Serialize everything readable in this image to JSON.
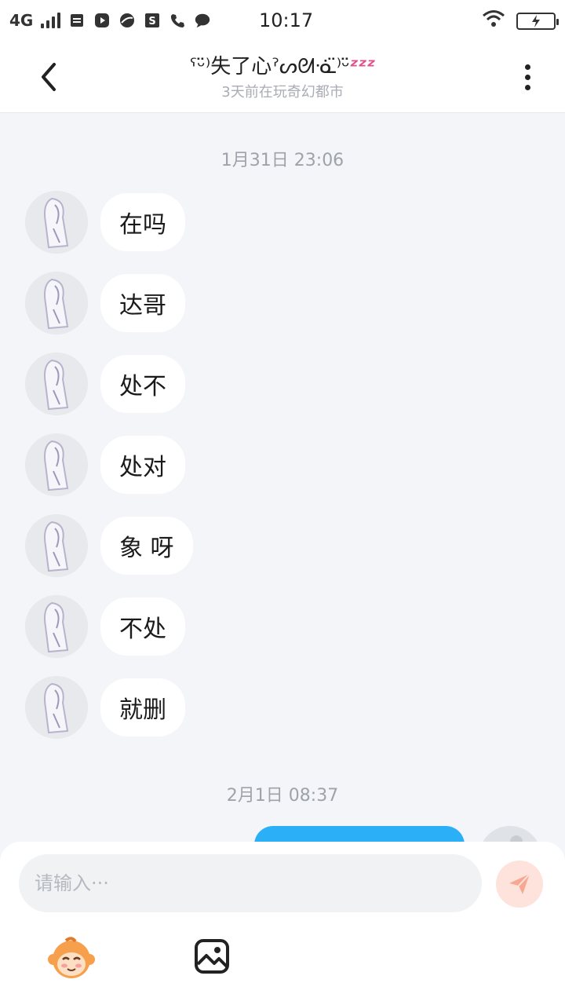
{
  "status_bar": {
    "network": "4G",
    "time": "10:17"
  },
  "nav": {
    "title": "ˁᵕ̈⁾失了心ˀᔕᘛᓍ̈⁾ᵕ̈",
    "title_deco": "ᶻᶻᶻ",
    "subtitle": "3天前在玩奇幻都市"
  },
  "chat": {
    "timestamps": [
      "1月31日 23:06",
      "2月1日 08:37"
    ],
    "messages": [
      {
        "text": "在吗"
      },
      {
        "text": "达哥"
      },
      {
        "text": "处不"
      },
      {
        "text": "处对"
      },
      {
        "text": "象 呀"
      },
      {
        "text": "不处"
      },
      {
        "text": "就删"
      }
    ]
  },
  "input": {
    "placeholder": "请输入···"
  },
  "colors": {
    "accent": "#2bb0f7",
    "send_bg": "#fde3dc",
    "send_icon": "#f7a892",
    "background": "#f3f5f8",
    "subtitle": "#a8adb5"
  },
  "icons": {
    "back": "chevron-left-icon",
    "more": "more-vertical-icon",
    "send": "paper-plane-icon",
    "emoji": "monkey-emoji-icon",
    "image": "image-icon"
  }
}
